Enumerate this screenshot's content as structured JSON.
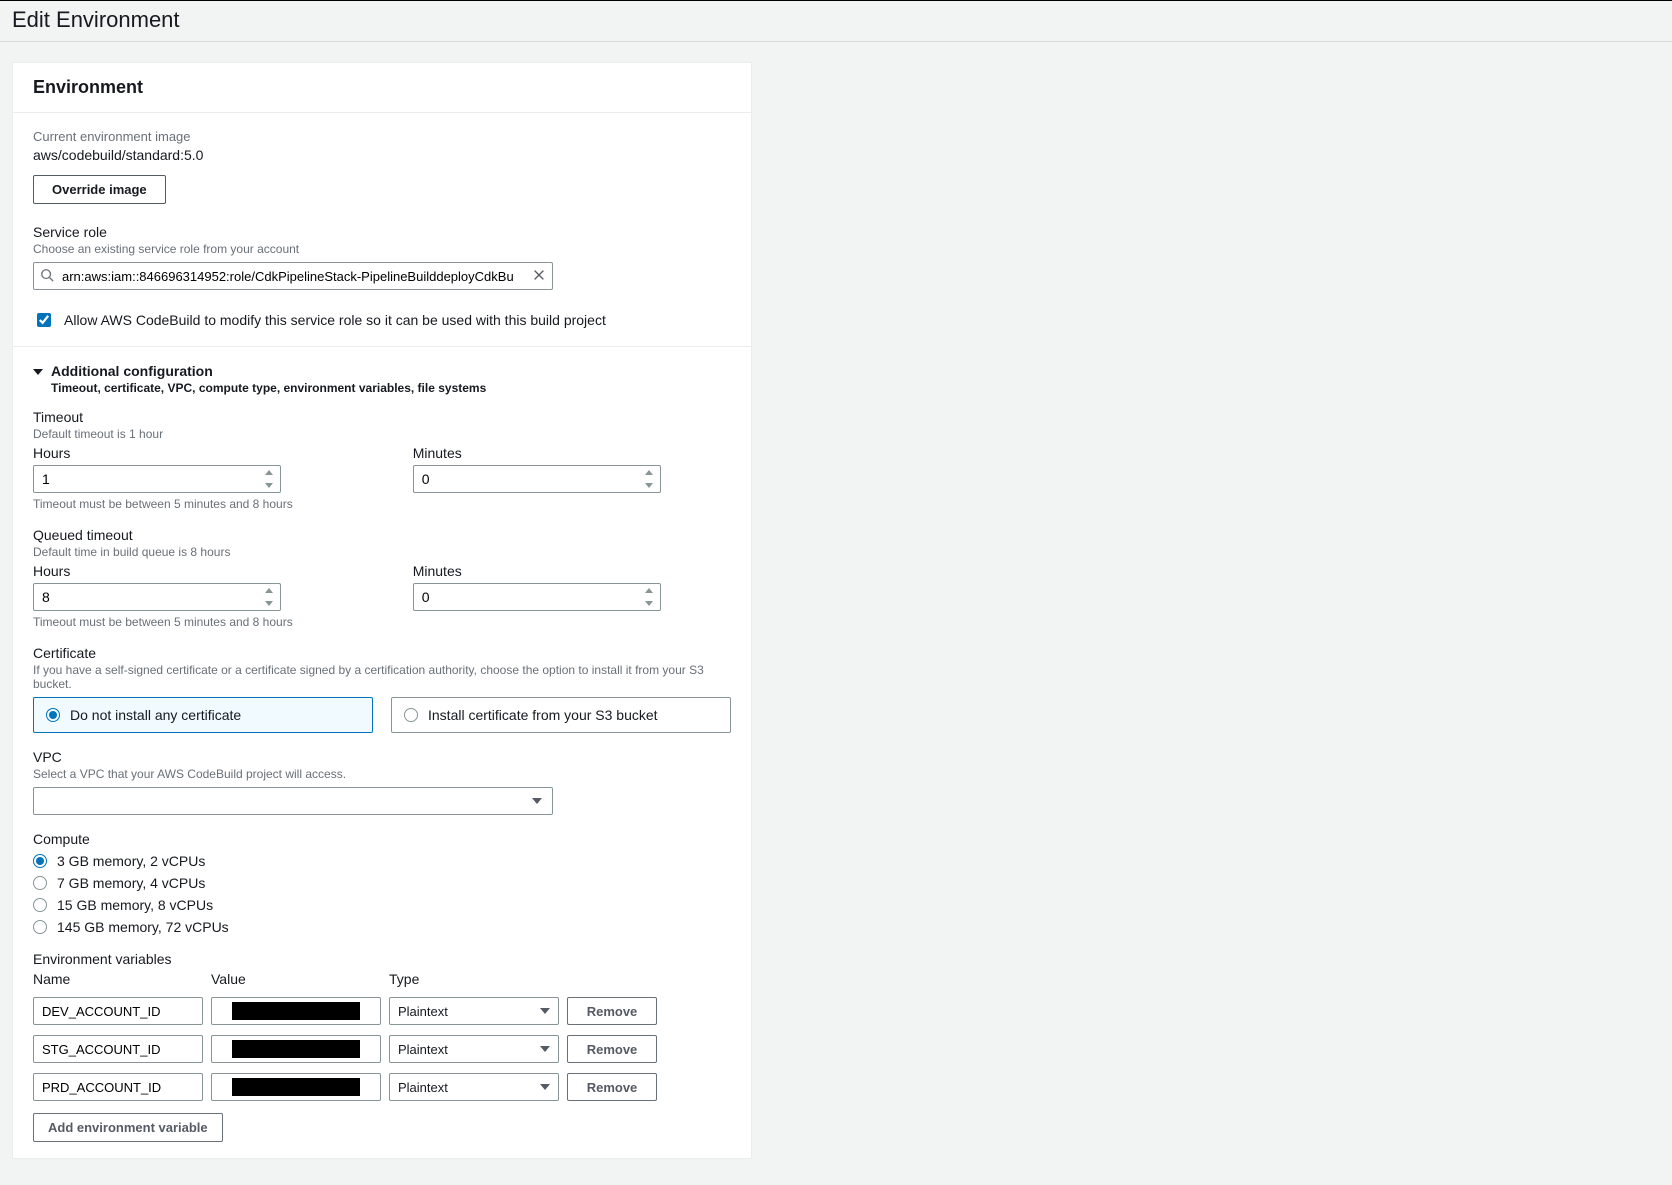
{
  "page": {
    "title": "Edit Environment"
  },
  "panel": {
    "title": "Environment"
  },
  "image": {
    "label": "Current environment image",
    "value": "aws/codebuild/standard:5.0",
    "override_button": "Override image"
  },
  "role": {
    "label": "Service role",
    "help": "Choose an existing service role from your account",
    "value": "arn:aws:iam::846696314952:role/CdkPipelineStack-PipelineBuilddeployCdkBu",
    "allow_modify": true,
    "allow_modify_label": "Allow AWS CodeBuild to modify this service role so it can be used with this build project"
  },
  "additional": {
    "title": "Additional configuration",
    "subtitle": "Timeout, certificate, VPC, compute type, environment variables, file systems"
  },
  "timeout": {
    "label": "Timeout",
    "help": "Default timeout is 1 hour",
    "hours_label": "Hours",
    "hours_value": "1",
    "minutes_label": "Minutes",
    "minutes_value": "0",
    "footer": "Timeout must be between 5 minutes and 8 hours"
  },
  "queued": {
    "label": "Queued timeout",
    "help": "Default time in build queue is 8 hours",
    "hours_label": "Hours",
    "hours_value": "8",
    "minutes_label": "Minutes",
    "minutes_value": "0",
    "footer": "Timeout must be between 5 minutes and 8 hours"
  },
  "certificate": {
    "label": "Certificate",
    "help": "If you have a self-signed certificate or a certificate signed by a certification authority, choose the option to install it from your S3 bucket.",
    "opt_none": "Do not install any certificate",
    "opt_s3": "Install certificate from your S3 bucket"
  },
  "vpc": {
    "label": "VPC",
    "help": "Select a VPC that your AWS CodeBuild project will access.",
    "value": ""
  },
  "compute": {
    "label": "Compute",
    "options": [
      "3 GB memory, 2 vCPUs",
      "7 GB memory, 4 vCPUs",
      "15 GB memory, 8 vCPUs",
      "145 GB memory, 72 vCPUs"
    ]
  },
  "env": {
    "label": "Environment variables",
    "col_name": "Name",
    "col_value": "Value",
    "col_type": "Type",
    "rows": [
      {
        "name": "DEV_ACCOUNT_ID",
        "type": "Plaintext",
        "remove": "Remove"
      },
      {
        "name": "STG_ACCOUNT_ID",
        "type": "Plaintext",
        "remove": "Remove"
      },
      {
        "name": "PRD_ACCOUNT_ID",
        "type": "Plaintext",
        "remove": "Remove"
      }
    ],
    "add_button": "Add environment variable"
  }
}
